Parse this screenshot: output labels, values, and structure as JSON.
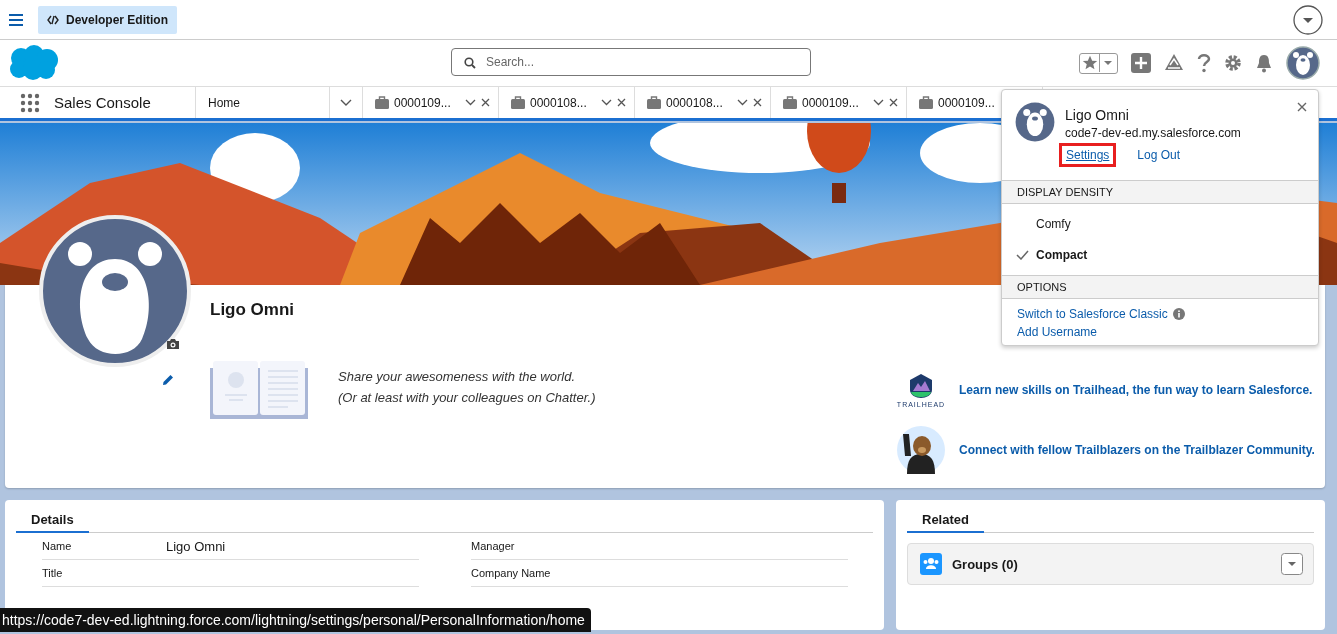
{
  "top_bar": {
    "edition_badge": "Developer Edition"
  },
  "header": {
    "search": {
      "placeholder": "Search..."
    }
  },
  "nav": {
    "app_name": "Sales Console",
    "home_tab": {
      "label": "Home",
      "selected": false
    },
    "tabs": [
      {
        "label": "0000109...",
        "selected": false,
        "controls_hidden": false
      },
      {
        "label": "0000108...",
        "selected": false,
        "controls_hidden": false
      },
      {
        "label": "0000108...",
        "selected": false,
        "controls_hidden": false
      },
      {
        "label": "0000109...",
        "selected": false,
        "controls_hidden": false
      },
      {
        "label": "0000109...",
        "selected": false,
        "controls_hidden": true
      }
    ]
  },
  "profile": {
    "name": "Ligo Omni",
    "prompt_lines": [
      "Share your awesomeness with the world.",
      "(Or at least with your colleagues on Chatter.)"
    ],
    "trailhead_label": "TRAILHEAD",
    "links": [
      {
        "kind": "trailhead",
        "label": "Learn new skills on Trailhead, the fun way to learn Salesforce."
      },
      {
        "kind": "community",
        "label": "Connect with fellow Trailblazers on the Trailblazer Community."
      }
    ]
  },
  "details": {
    "title": "Details",
    "fields": [
      {
        "label": "Name",
        "value": "Ligo Omni"
      },
      {
        "label": "Manager"
      },
      {
        "label": "Title"
      },
      {
        "label": "Company Name"
      }
    ]
  },
  "related": {
    "title": "Related",
    "cards": [
      {
        "title": "Groups (0)"
      }
    ]
  },
  "user_menu": {
    "name": "Ligo Omni",
    "domain": "code7-dev-ed.my.salesforce.com",
    "links": [
      {
        "label": "Settings",
        "highlighted": true
      },
      {
        "label": "Log Out",
        "highlighted": false
      }
    ],
    "density_heading": "DISPLAY DENSITY",
    "density_options": [
      {
        "label": "Comfy",
        "selected": false
      },
      {
        "label": "Compact",
        "selected": true
      }
    ],
    "options_heading": "OPTIONS",
    "options": [
      {
        "label": "Switch to Salesforce Classic",
        "info": true
      },
      {
        "label": "Add Username",
        "info": false
      }
    ]
  },
  "status_url": "https://code7-dev-ed.lightning.force.com/lightning/settings/personal/PersonalInformation/home"
}
